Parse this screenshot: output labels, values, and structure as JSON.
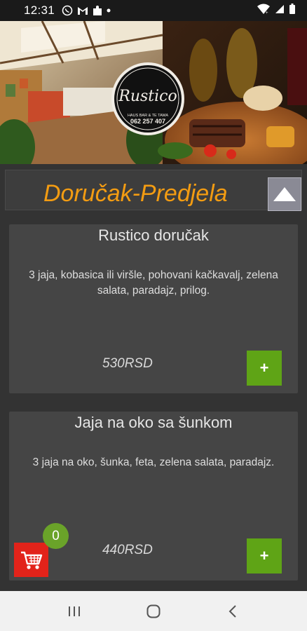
{
  "status_bar": {
    "time": "12:31",
    "notification_icons": [
      "viber-icon",
      "gmail-icon",
      "puzzle-icon",
      "dot-icon"
    ],
    "system_icons": [
      "wifi-icon",
      "signal-icon",
      "battery-icon"
    ]
  },
  "hero": {
    "logo_name": "Rustico",
    "logo_tagline": "HAUS BAR & TE TAMA",
    "logo_phone": "062 257 407"
  },
  "category": {
    "title": "Doručak-Predjela",
    "collapse_icon": "triangle-up-icon"
  },
  "menu_items": [
    {
      "name": "Rustico doručak",
      "description": "3 jaja, kobasica ili viršle, pohovani kačkavalj, zelena salata, paradajz, prilog.",
      "price": "530RSD",
      "add_label": "+"
    },
    {
      "name": "Jaja na oko sa šunkom",
      "description": "3 jaja na oko, šunka, feta, zelena salata, paradajz.",
      "price": "440RSD",
      "add_label": "+"
    }
  ],
  "cart": {
    "count": "0",
    "icon": "shopping-cart-icon"
  },
  "nav": {
    "recents_icon": "recents-icon",
    "home_icon": "home-icon",
    "back_icon": "back-icon"
  },
  "colors": {
    "accent_orange": "#f39c12",
    "add_green": "#5fa416",
    "cart_red": "#e2231a",
    "badge_green": "#6aa329",
    "card_bg": "#454545",
    "page_bg": "#333333"
  }
}
